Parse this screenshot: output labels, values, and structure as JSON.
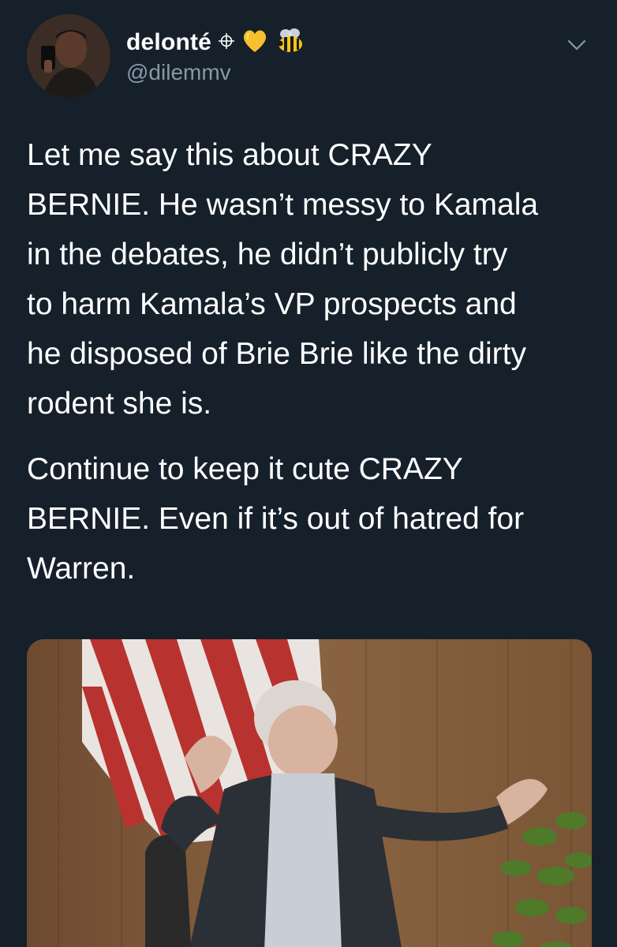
{
  "tweet": {
    "display_name": "delonté",
    "handle": "@dilemmv",
    "paragraphs": [
      "Let me say this about CRAZY\nBERNIE. He wasn’t messy to Kamala\nin the debates, he didn’t publicly try\nto harm Kamala’s VP prospects and\nhe disposed of Brie Brie like the dirty\nrodent she is.",
      "Continue to keep it cute CRAZY\nBERNIE. Even if it’s out of hatred for\nWarren."
    ]
  },
  "icons": {
    "name_badges": [
      "compass-icon",
      "yellow-heart-icon",
      "bee-icon"
    ],
    "menu": "chevron-down-icon"
  },
  "colors": {
    "background": "#15202b",
    "text": "#ffffff",
    "secondary_text": "#8899a6",
    "heart": "#f7c12c"
  }
}
